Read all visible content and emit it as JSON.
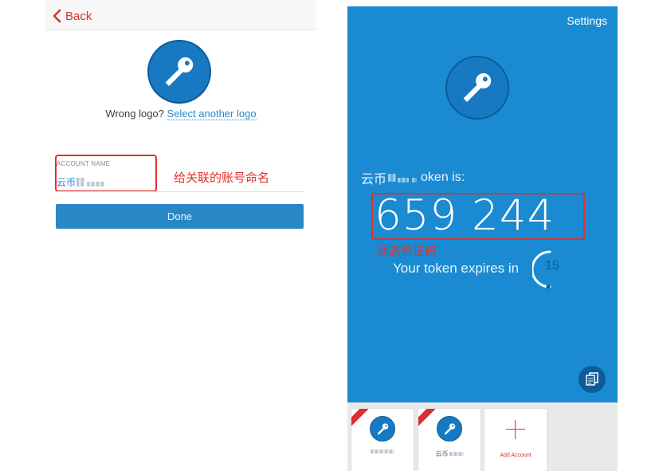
{
  "left_screen": {
    "back_label": "Back",
    "wrong_logo_text": "Wrong logo?",
    "select_logo_link": "Select another logo",
    "account_name_label": "ACCOUNT NAME",
    "account_name_value": "云币",
    "annotation": "给关联的账号命名",
    "done_label": "Done"
  },
  "right_screen": {
    "settings_label": "Settings",
    "token_label_prefix": "云币",
    "token_label_suffix": "oken is:",
    "token_code": "659 244",
    "annotation": "动态验证码",
    "expires_text": "Your token expires in",
    "countdown_value": "15",
    "accounts": [
      {
        "name": "",
        "has_badge": true
      },
      {
        "name": "云币",
        "has_badge": true
      }
    ],
    "add_account_label": "Add Account"
  },
  "icons": {
    "logo": "key-icon",
    "back": "chevron-left-icon",
    "copy": "copy-icon",
    "add": "plus-icon"
  },
  "colors": {
    "primary_blue": "#1a8bd2",
    "logo_blue": "#1679c1",
    "link_blue": "#2a86c6",
    "annotation_red": "#e0312c",
    "back_red": "#d8312f"
  }
}
